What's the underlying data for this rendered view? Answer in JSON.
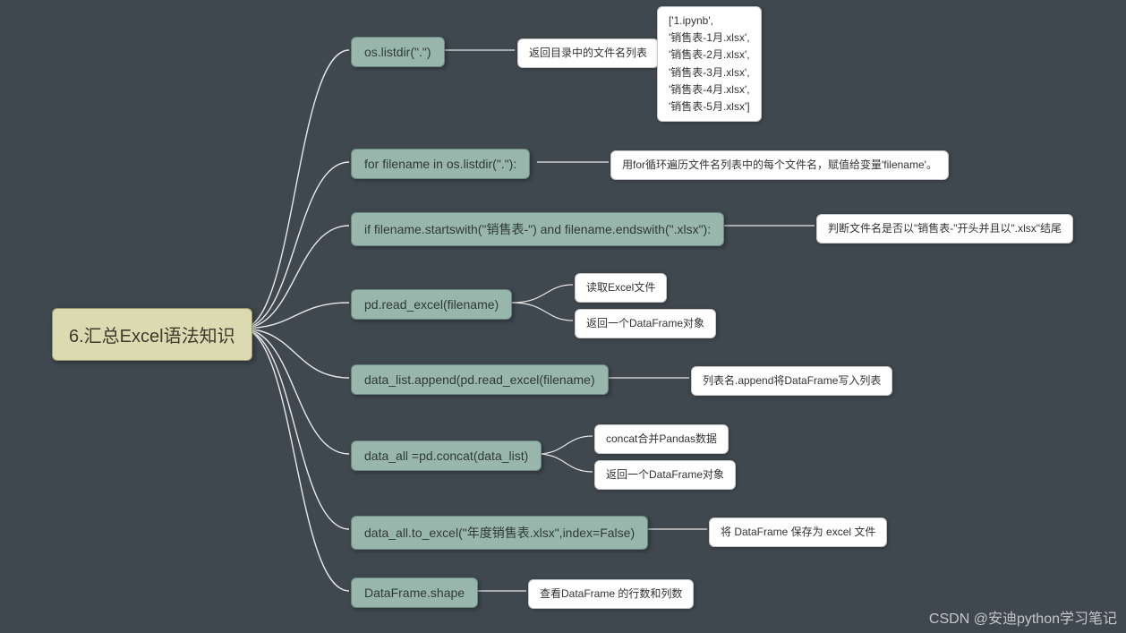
{
  "root": {
    "label": "6.汇总Excel语法知识"
  },
  "branches": [
    {
      "label": "os.listdir(\".\")",
      "leaves": [
        {
          "label": "返回目录中的文件名列表"
        },
        {
          "label": "['1.ipynb',\n'销售表-1月.xlsx',\n'销售表-2月.xlsx',\n'销售表-3月.xlsx',\n'销售表-4月.xlsx',\n'销售表-5月.xlsx']"
        }
      ]
    },
    {
      "label": "for filename in os.listdir(\".\"):",
      "leaves": [
        {
          "label": "用for循环遍历文件名列表中的每个文件名，赋值给变量'filename'。"
        }
      ]
    },
    {
      "label": "if filename.startswith(\"销售表-\") and filename.endswith(\".xlsx\"):",
      "leaves": [
        {
          "label": "判断文件名是否以\"销售表-\"开头并且以\".xlsx\"结尾"
        }
      ]
    },
    {
      "label": "pd.read_excel(filename)",
      "leaves": [
        {
          "label": "读取Excel文件"
        },
        {
          "label": "返回一个DataFrame对象"
        }
      ]
    },
    {
      "label": "data_list.append(pd.read_excel(filename)",
      "leaves": [
        {
          "label": "列表名.append将DataFrame写入列表"
        }
      ]
    },
    {
      "label": "data_all =pd.concat(data_list)",
      "leaves": [
        {
          "label": "concat合并Pandas数据"
        },
        {
          "label": "返回一个DataFrame对象"
        }
      ]
    },
    {
      "label": "data_all.to_excel(\"年度销售表.xlsx\",index=False)",
      "leaves": [
        {
          "label": "将 DataFrame 保存为 excel 文件"
        }
      ]
    },
    {
      "label": "DataFrame.shape",
      "leaves": [
        {
          "label": "查看DataFrame 的行数和列数"
        }
      ]
    }
  ],
  "watermark": "CSDN @安迪python学习笔记"
}
